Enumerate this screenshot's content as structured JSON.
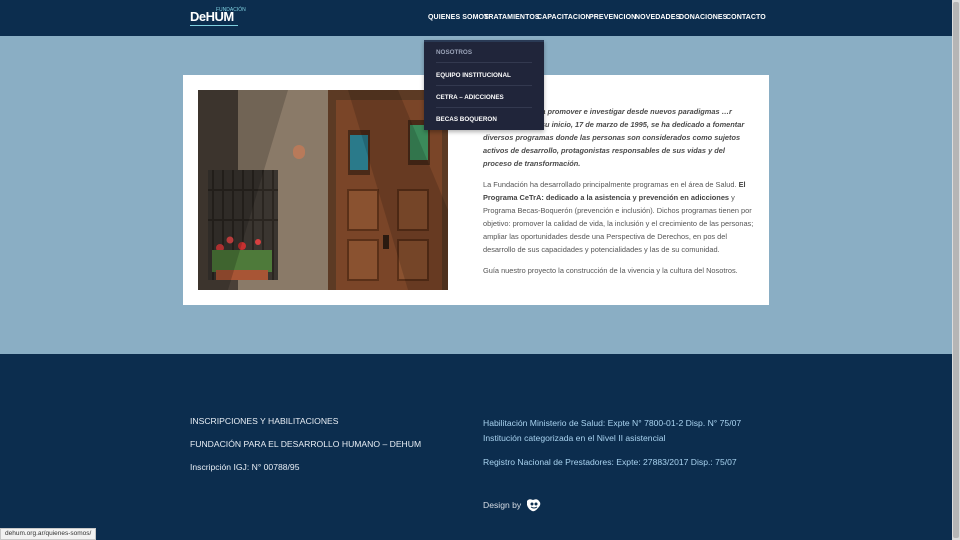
{
  "header": {
    "logo_text": "DeHUM",
    "logo_fund": "FUNDACIÓN",
    "nav": [
      {
        "label": "QUIENES SOMOS"
      },
      {
        "label": "TRATAMIENTOS"
      },
      {
        "label": "CAPACITACION"
      },
      {
        "label": "PREVENCION"
      },
      {
        "label": "NOVEDADES"
      },
      {
        "label": "DONACIONES"
      },
      {
        "label": "CONTACTO"
      }
    ]
  },
  "dropdown": {
    "items": [
      {
        "label": "NOSOTROS"
      },
      {
        "label": "EQUIPO INSTITUCIONAL"
      },
      {
        "label": "CETRA – ADICCIONES"
      },
      {
        "label": "BECAS BOQUERON"
      }
    ]
  },
  "content": {
    "para1": "…está dedicada a promover e investigar desde nuevos paradigmas …r Humano. Desde su inicio, 17 de marzo de 1995, se ha dedicado a fomentar diversos programas donde las personas son considerados como sujetos activos de desarrollo, protagonistas responsables de sus vidas y del proceso de transformación.",
    "para2_a": "La Fundación ha desarrollado principalmente programas en el área de Salud. ",
    "para2_bold": "El Programa CeTrA: dedicado a la asistencia y prevención en adicciones",
    "para2_b": " y Programa Becas-Boquerón (prevención e inclusión). Dichos programas tienen por objetivo: promover la calidad de vida, la inclusión y el crecimiento de las personas; ampliar las oportunidades desde una Perspectiva de Derechos, en pos del desarrollo de sus capacidades y potencialidades y las de su comunidad.",
    "para3": "Guía nuestro proyecto la construcción de la vivencia y la cultura del Nosotros."
  },
  "footer": {
    "left": [
      "INSCRIPCIONES Y HABILITACIONES",
      "FUNDACIÓN PARA EL DESARROLLO HUMANO – DEHUM",
      "Inscripción IGJ: N° 00788/95"
    ],
    "right_line1": "Habilitación Ministerio de Salud: Expte N° 7800-01-2 Disp. N° 75/07",
    "right_line2": "Institución categorizada en el Nivel II asistencial",
    "right_line3": "Registro Nacional de Prestadores: Expte: 27883/2017 Disp.: 75/07",
    "design_label": "Design by"
  },
  "status_url": "dehum.org.ar/quienes-somos/",
  "colors": {
    "header_bg": "#0c2d4e",
    "page_bg": "#8aaec4",
    "dropdown_bg": "#20253a",
    "footer_link": "#a9d3f0"
  }
}
